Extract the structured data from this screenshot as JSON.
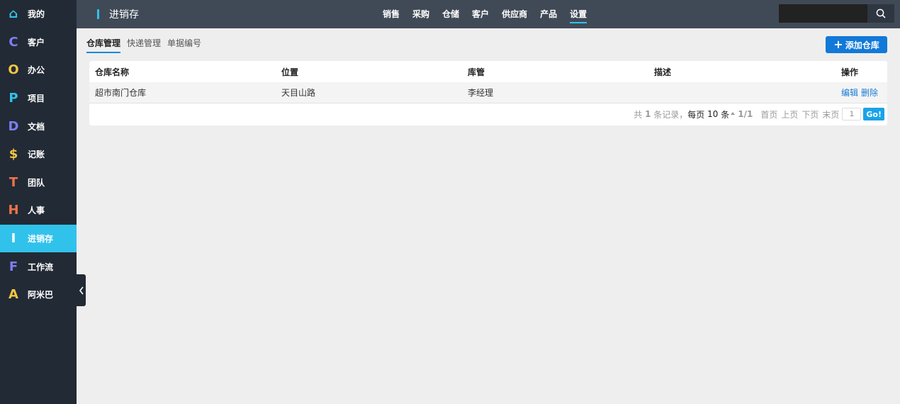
{
  "sidebar": {
    "items": [
      {
        "label": "我的",
        "icon": "home-icon",
        "glyph": "⌂",
        "color": "#31c2ec"
      },
      {
        "label": "客户",
        "icon": "letter-c-icon",
        "glyph": "C",
        "color": "#7d7ff0"
      },
      {
        "label": "办公",
        "icon": "letter-o-icon",
        "glyph": "O",
        "color": "#f2c744"
      },
      {
        "label": "项目",
        "icon": "letter-p-icon",
        "glyph": "P",
        "color": "#31c2ec"
      },
      {
        "label": "文档",
        "icon": "letter-d-icon",
        "glyph": "D",
        "color": "#7d7ff0"
      },
      {
        "label": "记账",
        "icon": "dollar-icon",
        "glyph": "$",
        "color": "#f2c744"
      },
      {
        "label": "团队",
        "icon": "letter-t-icon",
        "glyph": "T",
        "color": "#f0734a"
      },
      {
        "label": "人事",
        "icon": "letter-h-icon",
        "glyph": "H",
        "color": "#f0734a"
      },
      {
        "label": "进销存",
        "icon": "letter-i-icon",
        "glyph": "I",
        "color": "#ffffff"
      },
      {
        "label": "工作流",
        "icon": "letter-f-icon",
        "glyph": "F",
        "color": "#7d7ff0"
      },
      {
        "label": "阿米巴",
        "icon": "letter-a-icon",
        "glyph": "A",
        "color": "#f2c744"
      }
    ],
    "active_index": 8
  },
  "header": {
    "title": "进销存",
    "nav": [
      "销售",
      "采购",
      "仓储",
      "客户",
      "供应商",
      "产品",
      "设置"
    ],
    "active_nav": "设置",
    "search_placeholder": ""
  },
  "subtabs": [
    "仓库管理",
    "快递管理",
    "单据编号"
  ],
  "active_subtab": "仓库管理",
  "add_button": "添加仓库",
  "table": {
    "headers": [
      "仓库名称",
      "位置",
      "库管",
      "描述",
      "操作"
    ],
    "rows": [
      {
        "name": "超市南门仓库",
        "location": "天目山路",
        "manager": "李经理",
        "desc": "",
        "actions": [
          "编辑",
          "删除"
        ]
      }
    ]
  },
  "pager": {
    "total_prefix": "共",
    "total": "1",
    "total_suffix": "条记录，",
    "per_page_prefix": "每页",
    "per_page": "10",
    "per_page_suffix": "条",
    "page_info": "1/1",
    "first": "首页",
    "prev": "上页",
    "next": "下页",
    "last": "末页",
    "page_value": "1",
    "go": "Go!"
  },
  "colors": {
    "accent": "#31c2ec",
    "primary_button": "#1179d8",
    "sidebar_bg": "#222a35",
    "topbar_bg": "#404a57"
  }
}
